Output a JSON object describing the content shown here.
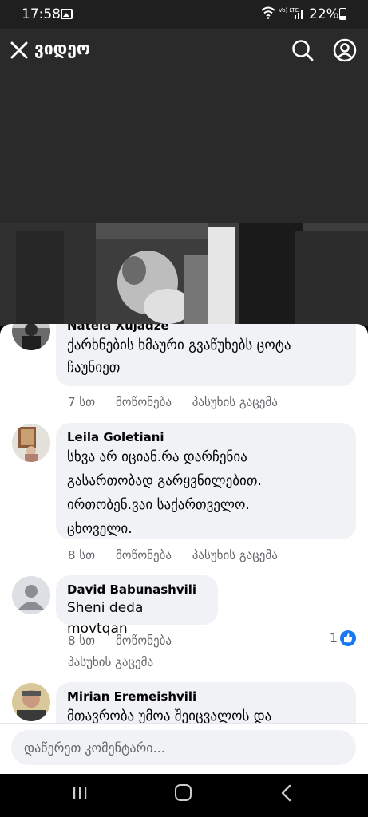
{
  "status_bar": {
    "time": "17:58",
    "battery": "22%",
    "network": "Vo) LTE"
  },
  "header": {
    "title": "ვიდეო"
  },
  "comments": [
    {
      "author": "Natela Xujadze",
      "text_lines": [
        "ქარხნების ხმაური გვაწუხებს ცოტა",
        "ჩაუნიეთ"
      ],
      "time": "7 სთ",
      "like_label": "მოწონება",
      "reply_label": "პასუხის გაცემა"
    },
    {
      "author": "Leila Goletiani",
      "text_lines": [
        "სხვა არ იციან.რა დარჩენია",
        "გასართობად გარყვნილებით.",
        "ირთობენ.ვაი საქართველო.",
        "ცხოველი."
      ],
      "time": "8 სთ",
      "like_label": "მოწონება",
      "reply_label": "პასუხის გაცემა"
    },
    {
      "author": "David Babunashvili",
      "text_lines": [
        "Sheni deda movtqan"
      ],
      "time": "8 სთ",
      "like_label": "მოწონება",
      "reply_label": "პასუხის გაცემა",
      "reaction_count": "1"
    },
    {
      "author": "Mirian Eremeishvili",
      "text_lines": [
        "მთავრობა უმოა შეიცვალოს და"
      ],
      "time": "",
      "like_label": "",
      "reply_label": ""
    }
  ],
  "composer": {
    "placeholder": "დაწერეთ კომენტარი..."
  },
  "colors": {
    "accent": "#1877f2",
    "bubble": "#f0f2f5",
    "meta": "#65676b"
  }
}
